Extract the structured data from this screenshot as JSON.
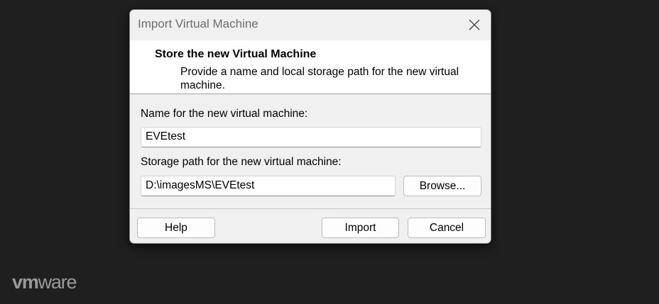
{
  "dialog": {
    "title": "Import Virtual Machine",
    "close_icon": "close-icon",
    "header": {
      "title": "Store the new Virtual Machine",
      "description": "Provide a name and local storage path for the new virtual machine."
    },
    "name_label": "Name for the new virtual machine:",
    "name_value": "EVEtest",
    "path_label": "Storage path for the new virtual machine:",
    "path_value": "D:\\imagesMS\\EVEtest",
    "browse_label": "Browse...",
    "help_label": "Help",
    "import_label": "Import",
    "cancel_label": "Cancel"
  },
  "brand": {
    "logo_vm": "vm",
    "logo_ware": "ware"
  },
  "colors": {
    "background": "#1f1f1f",
    "dialog_bg": "#f0f0f0",
    "header_bg": "#ffffff",
    "logo": "#9a9a9a"
  }
}
